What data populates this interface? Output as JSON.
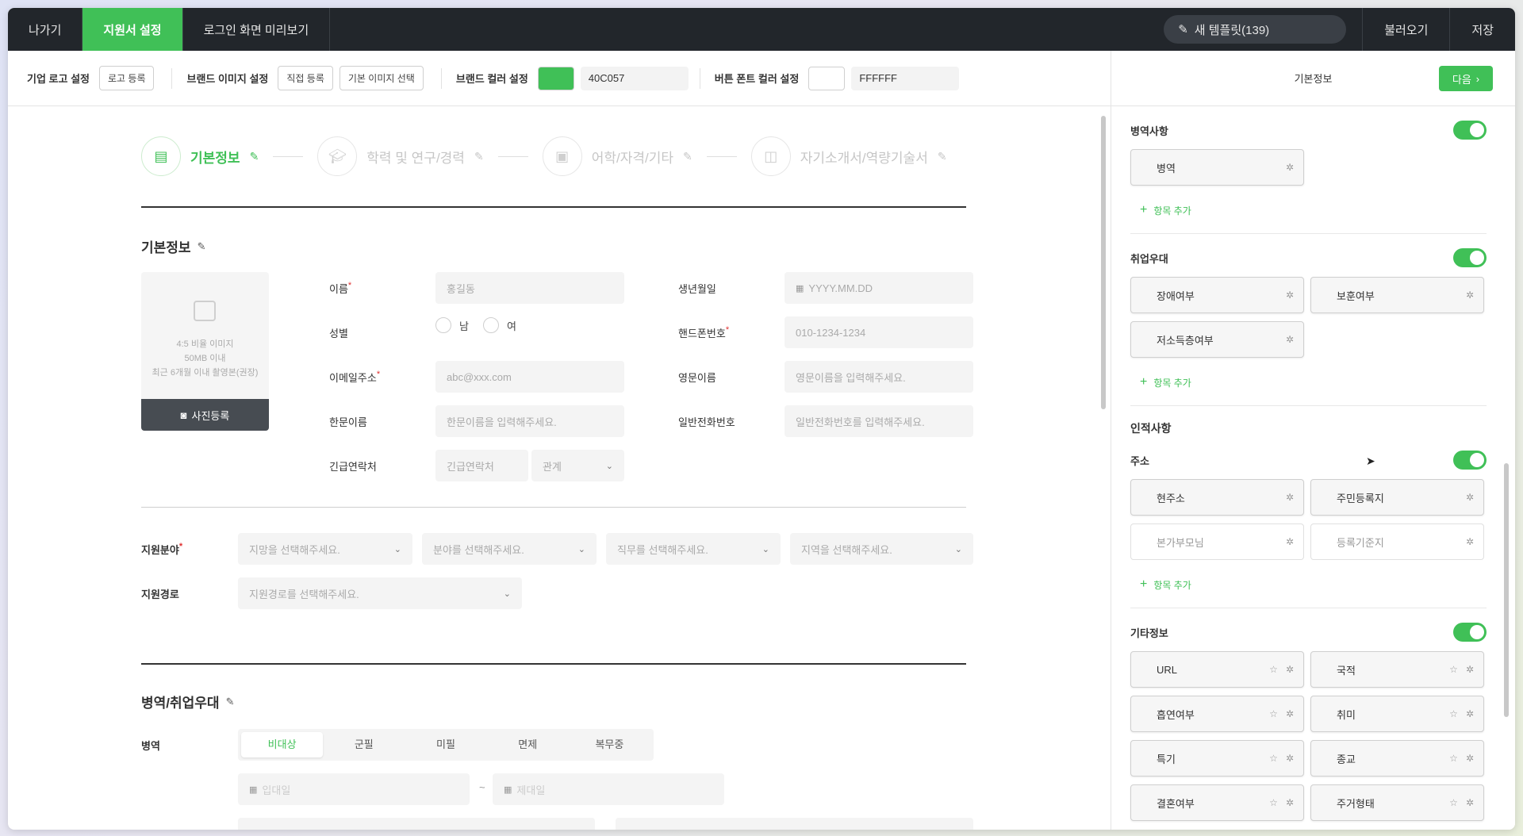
{
  "topbar": {
    "exit": "나가기",
    "settings_tab": "지원서 설정",
    "preview_tab": "로그인 화면 미리보기",
    "new_template": "새 템플릿(139)",
    "load": "불러오기",
    "save": "저장"
  },
  "settings_bar": {
    "logo_label": "기업 로고 설정",
    "logo_btn": "로고 등록",
    "brand_image_label": "브랜드 이미지 설정",
    "direct_btn": "직접 등록",
    "default_image_btn": "기본 이미지 선택",
    "brand_color_label": "브랜드 컬러 설정",
    "brand_color_hex": "40C057",
    "brand_color": "#40C057",
    "font_color_label": "버튼 폰트 컬러 설정",
    "font_color_hex": "FFFFFF",
    "font_color": "#FFFFFF"
  },
  "steps": [
    {
      "label": "기본정보",
      "icon": "document-icon"
    },
    {
      "label": "학력 및 연구/경력",
      "icon": "graduation-cap-icon"
    },
    {
      "label": "어학/자격/기타",
      "icon": "certificate-icon"
    },
    {
      "label": "자기소개서/역량기술서",
      "icon": "id-badge-icon"
    }
  ],
  "basic": {
    "title": "기본정보",
    "photo_desc1": "4:5 비율 이미지",
    "photo_desc2": "50MB 이내",
    "photo_desc3": "최근 6개월 이내 촬영본(권장)",
    "photo_btn": "사진등록",
    "name_label": "이름",
    "name_ph": "홍길동",
    "birth_label": "생년월일",
    "birth_ph": "YYYY.MM.DD",
    "gender_label": "성별",
    "male": "남",
    "female": "여",
    "phone_label": "핸드폰번호",
    "phone_ph": "010-1234-1234",
    "email_label": "이메일주소",
    "email_ph": "abc@xxx.com",
    "eng_label": "영문이름",
    "eng_ph": "영문이름을 입력해주세요.",
    "hanja_label": "한문이름",
    "hanja_ph": "한문이름을 입력해주세요.",
    "tel_label": "일반전화번호",
    "tel_ph": "일반전화번호를 입력해주세요.",
    "emergency_label": "긴급연락처",
    "emergency_ph": "긴급연락처",
    "relation_ph": "관계",
    "required_mark": "*"
  },
  "apply": {
    "field_label": "지원분야",
    "sel1": "지망을 선택해주세요.",
    "sel2": "분야를 선택해주세요.",
    "sel3": "직무를 선택해주세요.",
    "sel4": "지역을 선택해주세요.",
    "route_label": "지원경로",
    "route_ph": "지원경로를 선택해주세요."
  },
  "military": {
    "title": "병역/취업우대",
    "label": "병역",
    "options": [
      "비대상",
      "군필",
      "미필",
      "면제",
      "복무중"
    ],
    "enlist_ph": "입대일",
    "discharge_ph": "제대일",
    "tilde": "~"
  },
  "right": {
    "header": "기본정보",
    "next": "다음",
    "military_title": "병역사항",
    "military_items": [
      "병역"
    ],
    "add_item": "항목 추가",
    "pref_title": "취업우대",
    "pref_items": [
      "장애여부",
      "보훈여부",
      "저소득층여부"
    ],
    "personal_title": "인적사항",
    "address_title": "주소",
    "address_items": [
      "현주소",
      "주민등록지",
      "본가부모님",
      "등록기준지"
    ],
    "etc_title": "기타정보",
    "etc_items": [
      "URL",
      "국적",
      "흡연여부",
      "취미",
      "특기",
      "종교",
      "결혼여부",
      "주거형태"
    ]
  }
}
